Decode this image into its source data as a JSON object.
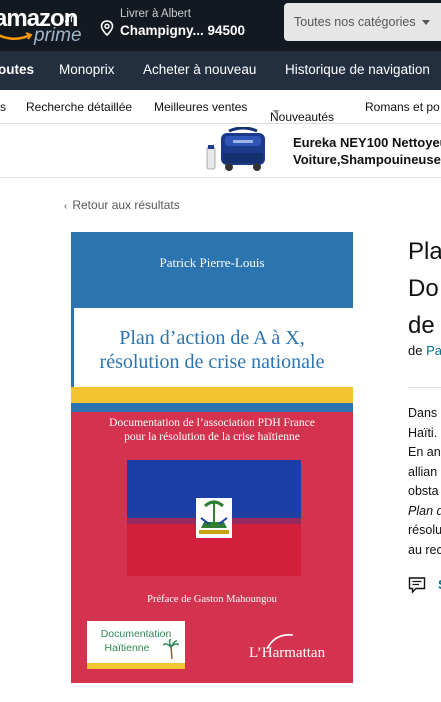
{
  "header": {
    "logo_text": "amazon",
    "logo_tld": ".fr",
    "logo_sub": "prime",
    "deliver_to": "Livrer à Albert",
    "location": "Champigny... 94500",
    "search_category": "Toutes nos catégories"
  },
  "subnav": {
    "items": [
      "outes",
      "Monoprix",
      "Acheter à nouveau",
      "Historique de navigation"
    ]
  },
  "thirdnav": {
    "items": [
      "s",
      "Recherche détaillée",
      "Meilleures ventes",
      "Nouveautés",
      "Romans et po"
    ]
  },
  "ad": {
    "line1": "Eureka NEY100 Nettoyeu",
    "line2": "Voiture,Shampouineuse"
  },
  "product": {
    "back_link": "Retour aux résultats",
    "cover": {
      "author": "Patrick Pierre-Louis",
      "title_line1": "Plan d’action de A à X,",
      "title_line2": "résolution de crise nationale",
      "subtitle_line1": "Documentation de l’association PDH France",
      "subtitle_line2": "pour la résolution de la crise haïtienne",
      "preface": "Préface de Gaston Mahoungou",
      "collection_line1": "Documentation",
      "collection_line2": "Haïtienne",
      "publisher": "L’Harmattan"
    },
    "title_lines": [
      "Pla",
      "Do",
      "de"
    ],
    "byline_prefix": "de",
    "byline_author": "Pa",
    "description_lines": [
      "Dans",
      "Haïti.",
      "En an",
      "allian",
      "obsta",
      "Plan d",
      "résolu",
      "au rec"
    ],
    "see_more": "S"
  },
  "colors": {
    "nav_dark": "#131921",
    "nav_secondary": "#232f3e",
    "link": "#007185",
    "cover_blue": "#2b74b0",
    "cover_red": "#d3334e",
    "cover_yellow": "#f2c530"
  }
}
